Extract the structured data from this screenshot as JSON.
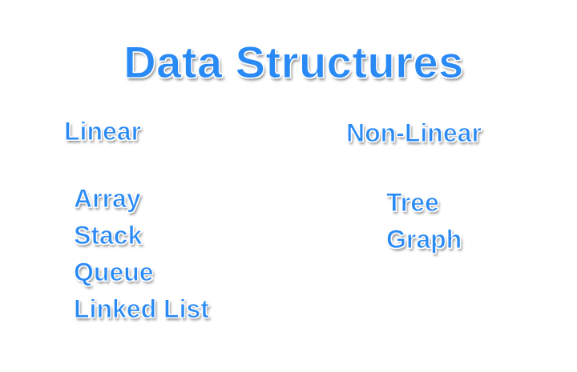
{
  "title": "Data Structures",
  "colors": {
    "text": "#2a8af5",
    "outline": "#ffffff",
    "background": "#ffffff"
  },
  "linear": {
    "heading": "Linear",
    "items": [
      "Array",
      "Stack",
      "Queue",
      "Linked List"
    ]
  },
  "non_linear": {
    "heading": "Non-Linear",
    "items": [
      "Tree",
      "Graph"
    ]
  }
}
